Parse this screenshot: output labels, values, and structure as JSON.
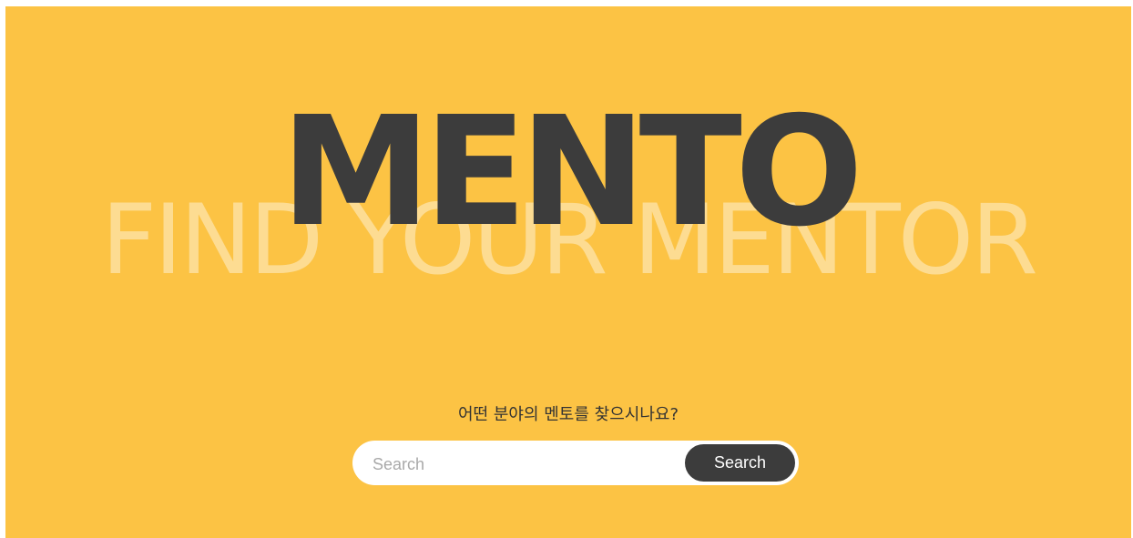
{
  "hero": {
    "background_text": "FIND YOUR MENTOR",
    "logo": "MENTO",
    "question": "어떤 분야의 멘토를 찾으시나요?"
  },
  "search": {
    "placeholder": "Search",
    "value": "",
    "button_label": "Search"
  },
  "colors": {
    "background": "#fcc344",
    "logo": "#3c3c3c",
    "button": "#3c3c3c",
    "input_bg": "#ffffff"
  }
}
